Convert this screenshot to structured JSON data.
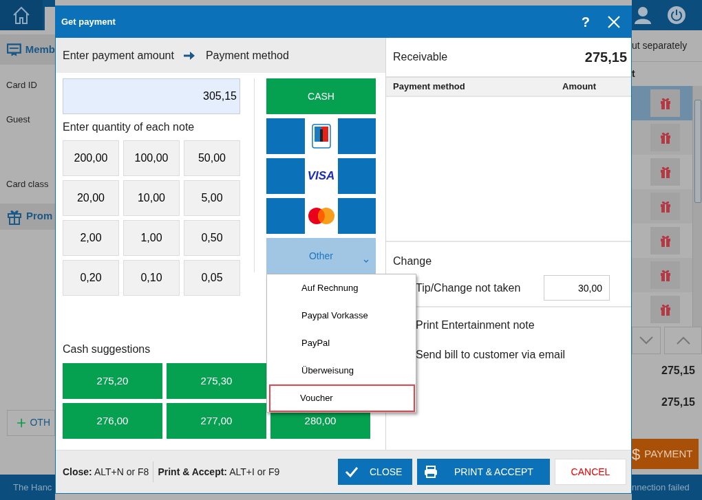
{
  "app_background": {
    "left_panel": {
      "member_heading": "Memb",
      "fields": [
        "Card ID",
        "Guest",
        "Card class"
      ],
      "promo_heading": "Prom",
      "other_button": "OTH",
      "status_text": "The Hanc"
    },
    "right_panel": {
      "option_text": "ut separately",
      "column_heading": "t",
      "rows": [
        {
          "selected": true
        },
        {
          "selected": false
        },
        {
          "selected": false
        },
        {
          "selected": false
        },
        {
          "selected": false
        },
        {
          "selected": false
        },
        {
          "selected": false
        }
      ],
      "totals": [
        "275,15",
        "275,15"
      ],
      "payment_button": {
        "symbol": "$",
        "label": "PAYMENT"
      },
      "status_text": "nnection failed"
    }
  },
  "dialog": {
    "title": "Get payment",
    "help": "?",
    "steps": [
      "Enter payment amount",
      "Payment method"
    ],
    "amount": "305,15",
    "notes_label": "Enter quantity of each note",
    "notes": [
      "200,00",
      "100,00",
      "50,00",
      "20,00",
      "10,00",
      "5,00",
      "2,00",
      "1,00",
      "0,50",
      "0,20",
      "0,10",
      "0,05"
    ],
    "payment_methods": [
      {
        "kind": "cash",
        "label": "CASH"
      },
      {
        "kind": "ec"
      },
      {
        "kind": "visa",
        "label": "VISA"
      },
      {
        "kind": "mastercard"
      },
      {
        "kind": "dropdown",
        "label": "Other",
        "expanded": true
      }
    ],
    "other_menu": [
      {
        "label": "Auf Rechnung",
        "selected": false
      },
      {
        "label": "Paypal Vorkasse",
        "selected": false
      },
      {
        "label": "PayPal",
        "selected": false
      },
      {
        "label": "Überweisung",
        "selected": false
      },
      {
        "label": "Voucher",
        "selected": true
      }
    ],
    "cash_suggestions_label": "Cash suggestions",
    "cash_suggestions": [
      [
        "275,20",
        "275,30"
      ],
      [
        "276,00",
        "277,00",
        "280,00"
      ]
    ],
    "receivable": {
      "label": "Receivable",
      "amount": "275,15"
    },
    "table_columns": [
      "Payment method",
      "Amount"
    ],
    "change_label": "Change",
    "tip": {
      "label": "Tip/Change not taken",
      "value": "30,00"
    },
    "options": [
      "Print Entertainment note",
      "Send bill to customer via email"
    ],
    "shortcuts": [
      "**Close:** ALT+N or F8",
      "**Print & Accept:** ALT+I or F9"
    ],
    "buttons": [
      {
        "kind": "close",
        "label": "CLOSE"
      },
      {
        "kind": "print",
        "label": "PRINT & ACCEPT"
      },
      {
        "kind": "cancel",
        "label": "CANCEL"
      }
    ]
  }
}
